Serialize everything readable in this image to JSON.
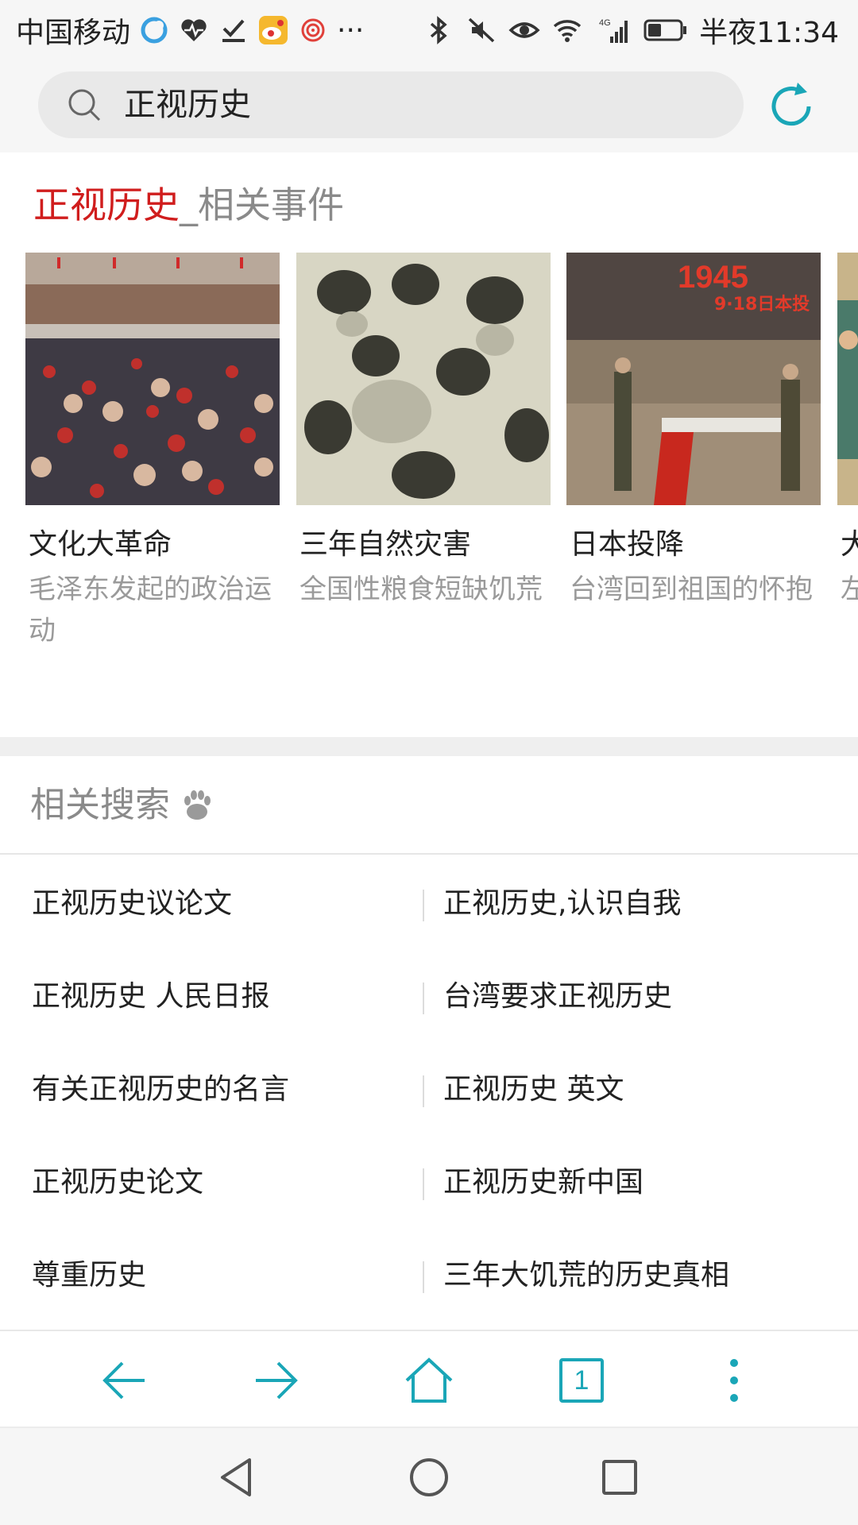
{
  "status_bar": {
    "carrier": "中国移动",
    "more": "···",
    "network": "4G",
    "time": "半夜11:34"
  },
  "search": {
    "query": "正视历史"
  },
  "events": {
    "keyword": "正视历史",
    "suffix": "_相关事件",
    "items": [
      {
        "title": "文化大革命",
        "desc": "毛泽东发起的政治运动"
      },
      {
        "title": "三年自然灾害",
        "desc": "全国性粮食短缺饥荒"
      },
      {
        "title": "日本投降",
        "desc": "台湾回到祖国的怀抱",
        "image_text": "1945",
        "image_text2": "9·18日本投"
      },
      {
        "title": "大",
        "desc": "左"
      }
    ]
  },
  "related": {
    "title": "相关搜索",
    "items": [
      [
        "正视历史议论文",
        "正视历史,认识自我"
      ],
      [
        "正视历史 人民日报",
        "台湾要求正视历史"
      ],
      [
        "有关正视历史的名言",
        "正视历史 英文"
      ],
      [
        "正视历史论文",
        "正视历史新中国"
      ],
      [
        "尊重历史",
        "三年大饥荒的历史真相"
      ]
    ]
  },
  "toolbar": {
    "tab_count": "1"
  },
  "colors": {
    "accent": "#1aa6b7",
    "keyword_red": "#d01d1d",
    "muted_text": "#9a9a9a"
  }
}
